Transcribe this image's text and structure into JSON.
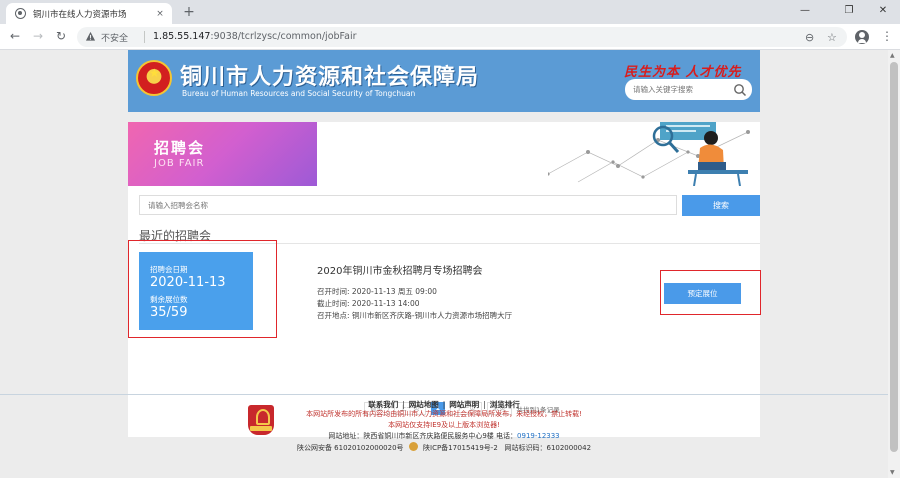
{
  "browser": {
    "tab_title": "铜川市在线人力资源市场",
    "tab_close": "×",
    "new_tab": "+",
    "window_controls": {
      "minimize": "—",
      "maximize": "❐",
      "close": "✕"
    },
    "nav": {
      "back": "←",
      "forward": "→",
      "reload": "↻"
    },
    "security_label": "不安全",
    "url_host": "1.85.55.147",
    "url_path": ":9038/tcrlzysc/common/jobFair",
    "zoom_icon_glyph": "⊖",
    "bookmark_glyph": "☆",
    "menu_glyph": "⋮"
  },
  "header": {
    "title": "铜川市人力资源和社会保障局",
    "subtitle": "Bureau of Human Resources and Social Security of Tongchuan",
    "slogan": "民生为本 人才优先",
    "search_placeholder": "请输入关键字搜索"
  },
  "banner": {
    "title": "招聘会",
    "subtitle": "JOB FAIR"
  },
  "fair_search": {
    "placeholder": "请输入招聘会名称",
    "button": "搜索"
  },
  "section": {
    "title": "最近的招聘会"
  },
  "fairs": [
    {
      "date_label": "招聘会日期",
      "date": "2020-11-13",
      "remaining_label": "剩余展位数",
      "remaining": "35/59",
      "title": "2020年铜川市金秋招聘月专场招聘会",
      "open_time_label": "召开时间:",
      "open_time": "2020-11-13 周五  09:00",
      "deadline_label": "截止时间:",
      "deadline": "2020-11-13 14:00",
      "location_label": "召开地点:",
      "location": "铜川市新区齐庆路-铜川市人力资源市场招聘大厅",
      "reserve_button": "预定展位"
    }
  ],
  "pagination": {
    "first": "首页",
    "prev": "上一页",
    "current": "1",
    "next": "下一页",
    "last": "末页",
    "summary": "共找到1条记录"
  },
  "footer": {
    "links": [
      "联系我们",
      "网站地图",
      "网站声明",
      "浏览排行"
    ],
    "copyright": "本网站所发布的所有内容均由铜川市人力资源和社会保障局所发布，未经授权，禁止转载!",
    "browser_note": "本网站仅支持IE9及以上版本浏览器!",
    "address": "网站地址：陕西省铜川市新区齐庆路便民服务中心9楼 电话：",
    "phone": "0919-12333",
    "police_record": "陕公网安备 61020102000020号",
    "icp": "陕ICP备17015419号-2",
    "site_id": "网站标识码：6102000042",
    "emblem_text": "党政机关"
  }
}
